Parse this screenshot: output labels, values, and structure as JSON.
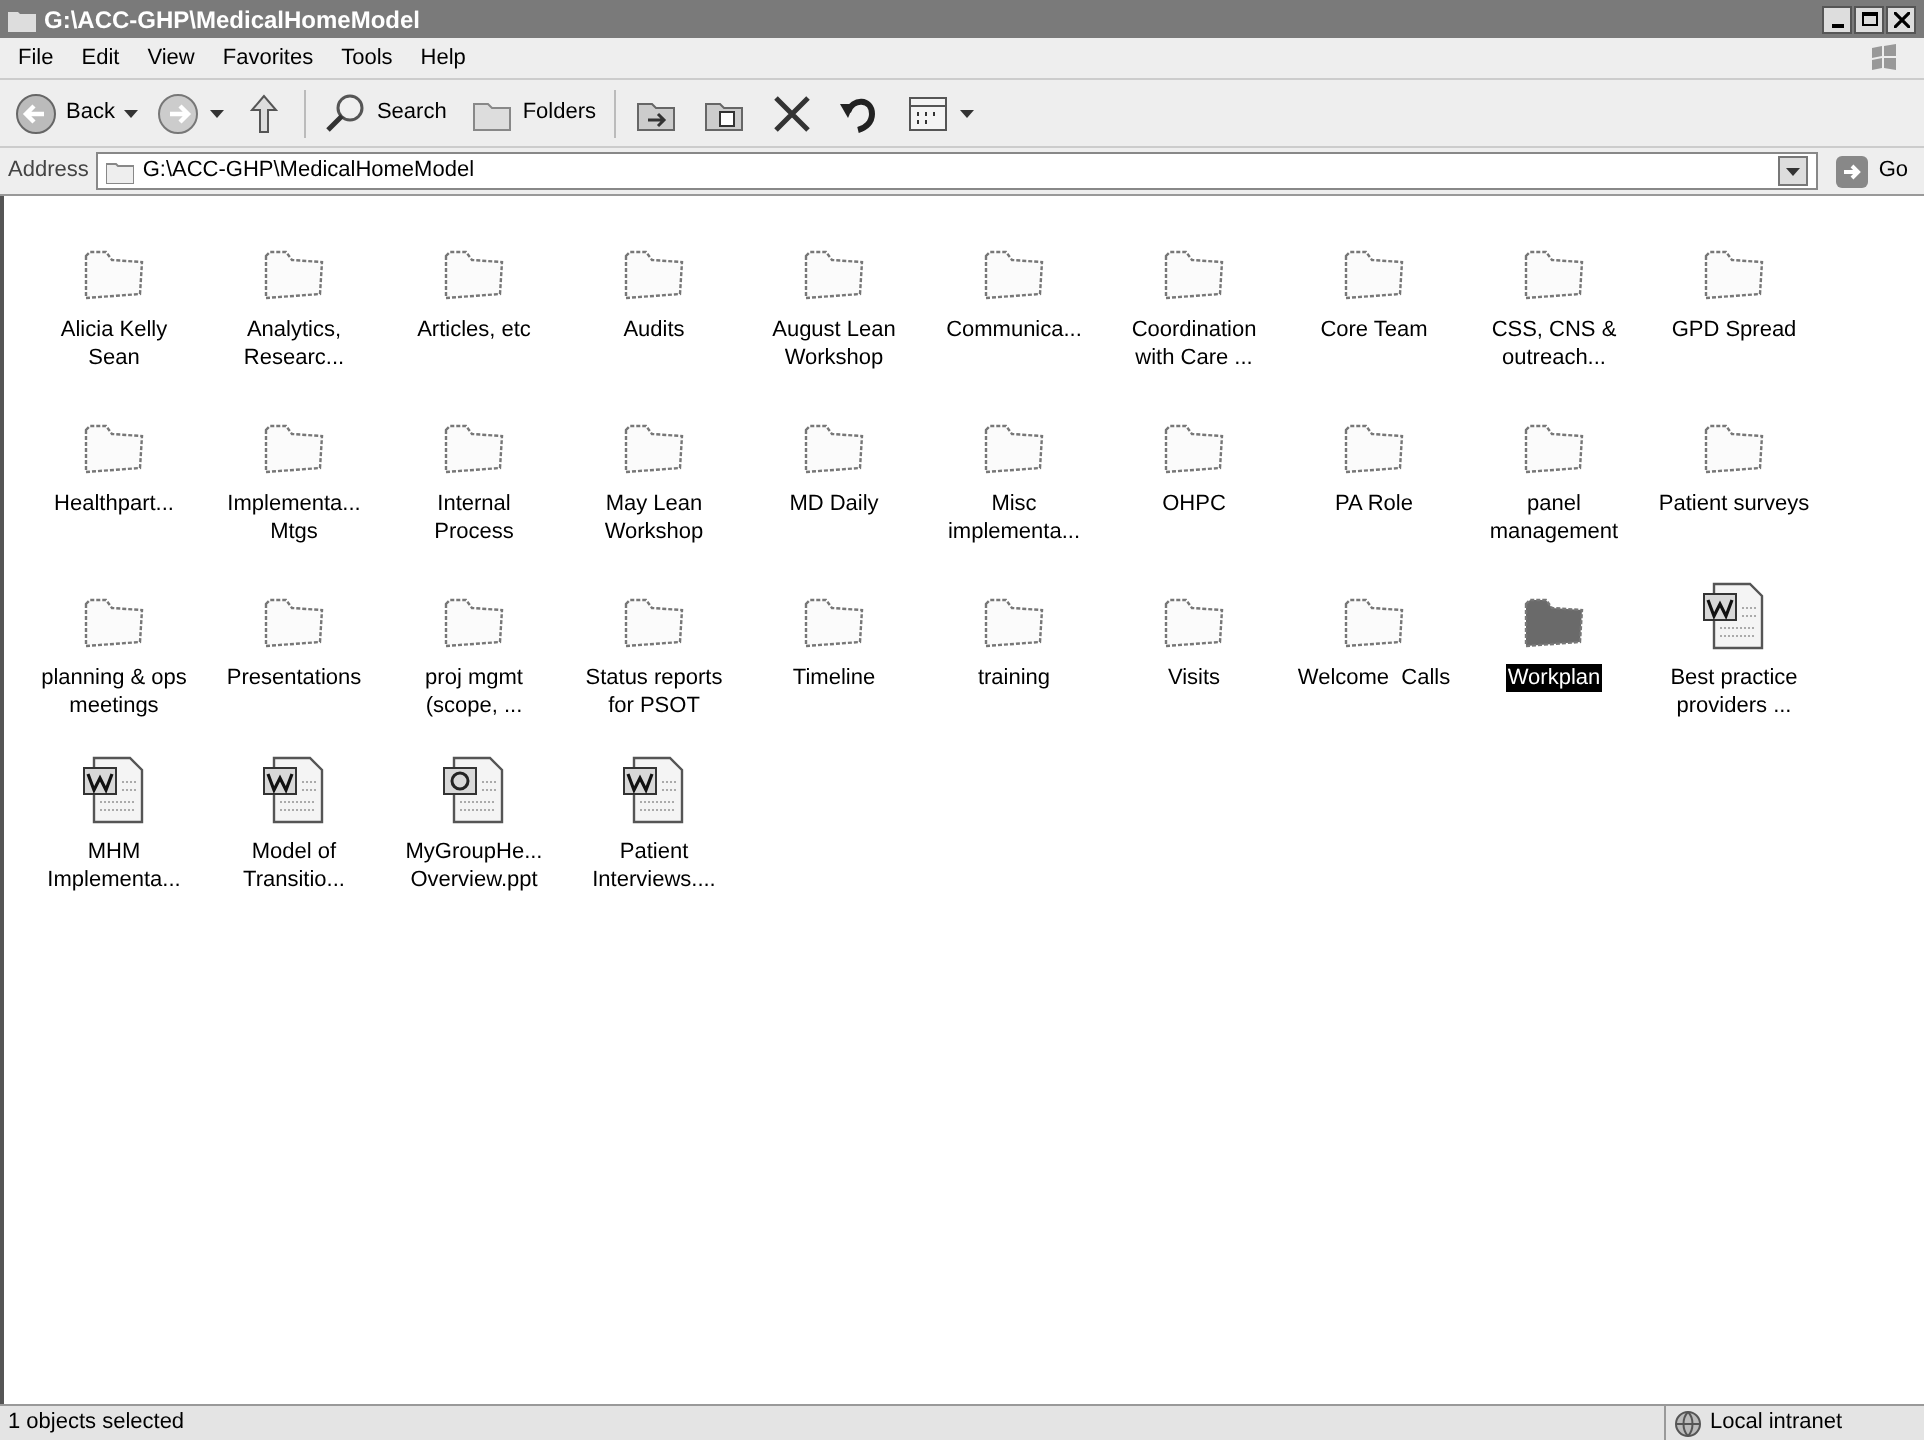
{
  "window": {
    "title": "G:\\ACC-GHP\\MedicalHomeModel"
  },
  "menu": [
    "File",
    "Edit",
    "View",
    "Favorites",
    "Tools",
    "Help"
  ],
  "toolbar": [
    {
      "kind": "back",
      "label": "Back"
    },
    {
      "kind": "forward"
    },
    {
      "kind": "up"
    },
    {
      "kind": "search",
      "label": "Search"
    },
    {
      "kind": "folders",
      "label": "Folders"
    },
    {
      "kind": "move"
    },
    {
      "kind": "copy"
    },
    {
      "kind": "delete"
    },
    {
      "kind": "undo"
    },
    {
      "kind": "views"
    }
  ],
  "address": {
    "label": "Address",
    "value": "G:\\ACC-GHP\\MedicalHomeModel",
    "go": "Go"
  },
  "items": [
    {
      "kind": "folder",
      "name": "Alicia Kelly Sean",
      "selected": false
    },
    {
      "kind": "folder",
      "name": "Analytics, Researc...",
      "selected": false
    },
    {
      "kind": "folder",
      "name": "Articles, etc",
      "selected": false
    },
    {
      "kind": "folder",
      "name": "Audits",
      "selected": false
    },
    {
      "kind": "folder",
      "name": "August Lean Workshop",
      "selected": false
    },
    {
      "kind": "folder",
      "name": "Communica...",
      "selected": false
    },
    {
      "kind": "folder",
      "name": "Coordination with Care ...",
      "selected": false
    },
    {
      "kind": "folder",
      "name": "Core Team",
      "selected": false
    },
    {
      "kind": "folder",
      "name": "CSS, CNS & outreach...",
      "selected": false
    },
    {
      "kind": "folder",
      "name": "GPD Spread",
      "selected": false
    },
    {
      "kind": "folder",
      "name": "Healthpart...",
      "selected": false
    },
    {
      "kind": "folder",
      "name": "Implementa... Mtgs",
      "selected": false
    },
    {
      "kind": "folder",
      "name": "Internal Process",
      "selected": false
    },
    {
      "kind": "folder",
      "name": "May Lean Workshop",
      "selected": false
    },
    {
      "kind": "folder",
      "name": "MD Daily",
      "selected": false
    },
    {
      "kind": "folder",
      "name": "Misc implementa...",
      "selected": false
    },
    {
      "kind": "folder",
      "name": "OHPC",
      "selected": false
    },
    {
      "kind": "folder",
      "name": "PA Role",
      "selected": false
    },
    {
      "kind": "folder",
      "name": "panel management",
      "selected": false
    },
    {
      "kind": "folder",
      "name": "Patient surveys",
      "selected": false
    },
    {
      "kind": "folder",
      "name": "planning & ops meetings",
      "selected": false
    },
    {
      "kind": "folder",
      "name": "Presentations",
      "selected": false
    },
    {
      "kind": "folder",
      "name": "proj mgmt (scope, ...",
      "selected": false
    },
    {
      "kind": "folder",
      "name": "Status reports for PSOT",
      "selected": false
    },
    {
      "kind": "folder",
      "name": "Timeline",
      "selected": false
    },
    {
      "kind": "folder",
      "name": "training",
      "selected": false
    },
    {
      "kind": "folder",
      "name": "Visits",
      "selected": false
    },
    {
      "kind": "folder",
      "name": "Welcome  Calls",
      "selected": false
    },
    {
      "kind": "folder",
      "name": "Workplan",
      "selected": true
    },
    {
      "kind": "word",
      "name": "Best practice providers ...",
      "selected": false
    },
    {
      "kind": "word",
      "name": "MHM Implementa...",
      "selected": false
    },
    {
      "kind": "word",
      "name": "Model of Transitio...",
      "selected": false
    },
    {
      "kind": "ppt",
      "name": "MyGroupHe... Overview.ppt",
      "selected": false
    },
    {
      "kind": "word",
      "name": "Patient Interviews....",
      "selected": false
    }
  ],
  "status_bar": {
    "text": "1 objects selected",
    "zone": "Local intranet"
  }
}
